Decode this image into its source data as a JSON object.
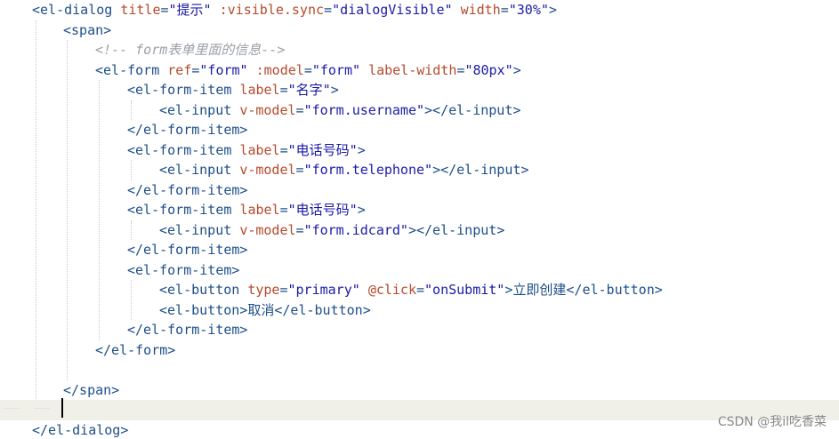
{
  "editor": {
    "lines": [
      {
        "tokens": [
          [
            "tag",
            "<el-dialog "
          ],
          [
            "attr",
            "title"
          ],
          [
            "tag",
            "="
          ],
          [
            "val",
            "\"提示\""
          ],
          [
            "tag",
            " "
          ],
          [
            "attr",
            ":visible.sync"
          ],
          [
            "tag",
            "="
          ],
          [
            "val",
            "\"dialogVisible\""
          ],
          [
            "tag",
            " "
          ],
          [
            "attr",
            "width"
          ],
          [
            "tag",
            "="
          ],
          [
            "val",
            "\"30%\""
          ],
          [
            "tag",
            ">"
          ]
        ]
      },
      {
        "tokens": [
          [
            "tag",
            "<span>"
          ]
        ]
      },
      {
        "tokens": [
          [
            "cmt",
            "<!-- form表单里面的信息-->"
          ]
        ]
      },
      {
        "tokens": [
          [
            "tag",
            "<el-form "
          ],
          [
            "attr",
            "ref"
          ],
          [
            "tag",
            "="
          ],
          [
            "val",
            "\"form\""
          ],
          [
            "tag",
            " "
          ],
          [
            "attr",
            ":model"
          ],
          [
            "tag",
            "="
          ],
          [
            "val",
            "\"form\""
          ],
          [
            "tag",
            " "
          ],
          [
            "attr",
            "label-width"
          ],
          [
            "tag",
            "="
          ],
          [
            "val",
            "\"80px\""
          ],
          [
            "tag",
            ">"
          ]
        ]
      },
      {
        "tokens": [
          [
            "tag",
            "<el-form-item "
          ],
          [
            "attr",
            "label"
          ],
          [
            "tag",
            "="
          ],
          [
            "val",
            "\"名字\""
          ],
          [
            "tag",
            ">"
          ]
        ]
      },
      {
        "tokens": [
          [
            "tag",
            "<el-input "
          ],
          [
            "attr",
            "v-model"
          ],
          [
            "tag",
            "="
          ],
          [
            "val",
            "\"form.username\""
          ],
          [
            "tag",
            "></el-input>"
          ]
        ]
      },
      {
        "tokens": [
          [
            "tag",
            "</el-form-item>"
          ]
        ]
      },
      {
        "tokens": [
          [
            "tag",
            "<el-form-item "
          ],
          [
            "attr",
            "label"
          ],
          [
            "tag",
            "="
          ],
          [
            "val",
            "\"电话号码\""
          ],
          [
            "tag",
            ">"
          ]
        ]
      },
      {
        "tokens": [
          [
            "tag",
            "<el-input "
          ],
          [
            "attr",
            "v-model"
          ],
          [
            "tag",
            "="
          ],
          [
            "val",
            "\"form.telephone\""
          ],
          [
            "tag",
            "></el-input>"
          ]
        ]
      },
      {
        "tokens": [
          [
            "tag",
            "</el-form-item>"
          ]
        ]
      },
      {
        "tokens": [
          [
            "tag",
            "<el-form-item "
          ],
          [
            "attr",
            "label"
          ],
          [
            "tag",
            "="
          ],
          [
            "val",
            "\"电话号码\""
          ],
          [
            "tag",
            ">"
          ]
        ]
      },
      {
        "tokens": [
          [
            "tag",
            "<el-input "
          ],
          [
            "attr",
            "v-model"
          ],
          [
            "tag",
            "="
          ],
          [
            "val",
            "\"form.idcard\""
          ],
          [
            "tag",
            "></el-input>"
          ]
        ]
      },
      {
        "tokens": [
          [
            "tag",
            "</el-form-item>"
          ]
        ]
      },
      {
        "tokens": [
          [
            "tag",
            "<el-form-item>"
          ]
        ]
      },
      {
        "tokens": [
          [
            "tag",
            "<el-button "
          ],
          [
            "attr",
            "type"
          ],
          [
            "tag",
            "="
          ],
          [
            "val",
            "\"primary\""
          ],
          [
            "tag",
            " "
          ],
          [
            "attr",
            "@click"
          ],
          [
            "tag",
            "="
          ],
          [
            "val",
            "\"onSubmit\""
          ],
          [
            "tag",
            ">"
          ],
          [
            "txt",
            "立即创建"
          ],
          [
            "tag",
            "</el-button>"
          ]
        ]
      },
      {
        "tokens": [
          [
            "tag",
            "<el-button>"
          ],
          [
            "txt",
            "取消"
          ],
          [
            "tag",
            "</el-button>"
          ]
        ]
      },
      {
        "tokens": [
          [
            "tag",
            "</el-form-item>"
          ]
        ]
      },
      {
        "tokens": [
          [
            "tag",
            "</el-form>"
          ]
        ]
      },
      {
        "tokens": []
      },
      {
        "tokens": [
          [
            "tag",
            "</span>"
          ]
        ]
      },
      {
        "tokens": []
      },
      {
        "tokens": [
          [
            "tag",
            "</el-dialog>"
          ]
        ]
      }
    ]
  },
  "watermark": "CSDN @我il吃香菜"
}
